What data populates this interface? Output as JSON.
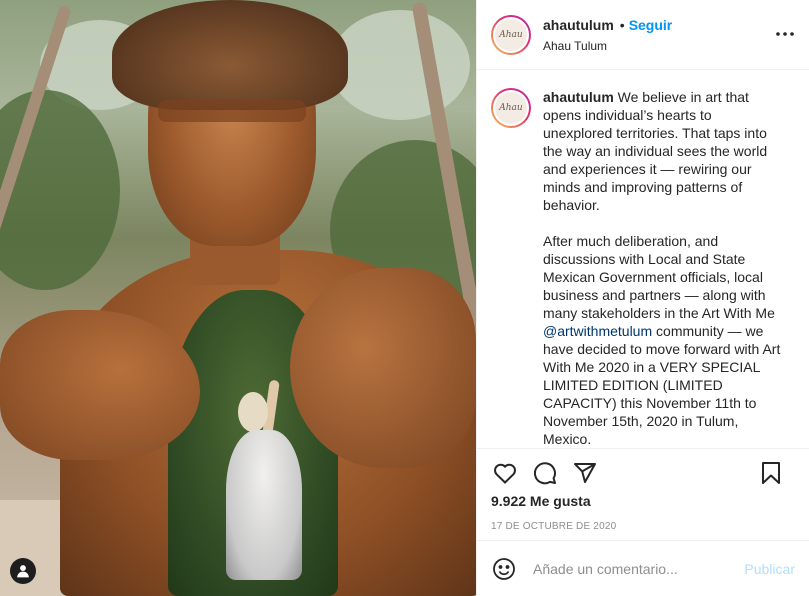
{
  "post": {
    "image": {
      "alt_icon": "user-tag-icon"
    },
    "header": {
      "username": "ahautulum",
      "separator": "•",
      "follow_label": "Seguir",
      "location": "Ahau Tulum",
      "avatar_logo_text": "Ahau",
      "more_icon": "ellipsis-icon"
    },
    "caption": {
      "username": "ahautulum",
      "text_part1": "We believe in art that opens individual’s hearts to unexplored territories. That taps into the way an individual sees the world and experiences it — rewiring our minds and improving patterns of behavior.\n\nAfter much deliberation, and discussions with Local and State Mexican Government officials, local business and partners — along with many stakeholders in the Art With Me ",
      "mention": "@artwithmetulum",
      "text_part2": " community — we have decided to move forward with Art With Me 2020 in a VERY SPECIAL LIMITED EDITION (LIMITED CAPACITY) this November 11th to November 15th, 2020 in Tulum, Mexico."
    },
    "actions": {
      "like_icon": "heart-icon",
      "comment_icon": "comment-icon",
      "share_icon": "paper-plane-icon",
      "save_icon": "bookmark-icon",
      "likes": "9.922 Me gusta",
      "date": "17 DE OCTUBRE DE 2020"
    },
    "comment_box": {
      "emoji_icon": "smiley-icon",
      "placeholder": "Añade un comentario...",
      "value": "",
      "publish_label": "Publicar"
    }
  },
  "colors": {
    "accent": "#0095f6",
    "publish_disabled": "#b2dffc",
    "mention": "#00376b",
    "muted": "#8e8e8e",
    "border": "#efefef"
  }
}
